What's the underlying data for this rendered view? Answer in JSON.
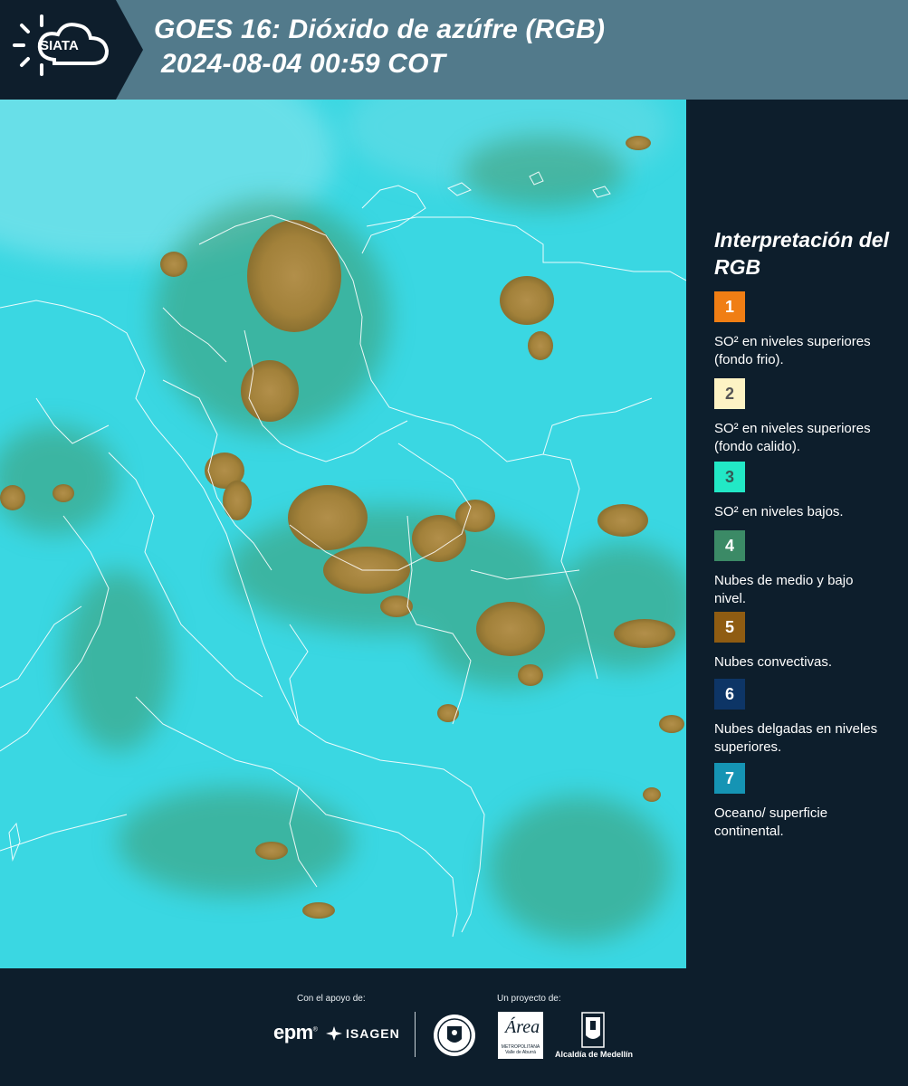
{
  "header": {
    "logo_text": "SIATA",
    "title_line1": "GOES 16: Dióxido de azúfre (RGB)",
    "title_line2": "2024-08-04 00:59 COT"
  },
  "map": {
    "description_icon": "satellite-rgb-map",
    "background_color": "#37d6e0",
    "cloud_color_convective": "#a07d32",
    "cloud_color_mid_low": "#3c9a6e",
    "border_color": "#ffffff"
  },
  "legend": {
    "title": "Interpretación del RGB",
    "items": [
      {
        "number": "1",
        "color": "#f07e14",
        "text_color": "#ffffff",
        "description": "SO² en niveles superiores (fondo frio)."
      },
      {
        "number": "2",
        "color": "#fdf3c4",
        "text_color": "#555555",
        "description": "SO² en niveles superiores (fondo calido)."
      },
      {
        "number": "3",
        "color": "#22e8c6",
        "text_color": "#335a55",
        "description": "SO² en niveles bajos."
      },
      {
        "number": "4",
        "color": "#3b8a66",
        "text_color": "#ffffff",
        "description": "Nubes de medio y bajo nivel."
      },
      {
        "number": "5",
        "color": "#8f5c12",
        "text_color": "#ffffff",
        "description": "Nubes convectivas."
      },
      {
        "number": "6",
        "color": "#0d3566",
        "text_color": "#ffffff",
        "description": "Nubes delgadas en niveles superiores."
      },
      {
        "number": "7",
        "color": "#1594b4",
        "text_color": "#ffffff",
        "description": "Oceano/ superficie continental."
      }
    ]
  },
  "footer": {
    "support_label": "Con el apoyo de:",
    "project_label": "Un proyecto de:",
    "epm_text": "epm",
    "isagen_text": "ISAGEN",
    "area_text": "Área",
    "area_sub": "METROPOLITANA Valle de Aburrá",
    "alcaldia_text": "Alcaldía de Medellín"
  }
}
